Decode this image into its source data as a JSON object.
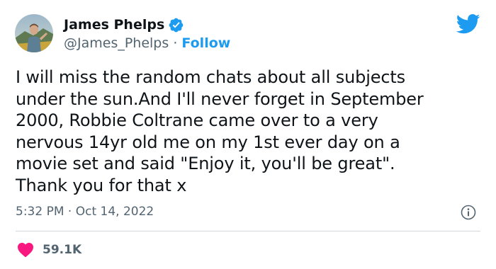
{
  "author": {
    "name": "James Phelps",
    "handle": "@James_Phelps",
    "separator": "·",
    "follow_label": "Follow",
    "verified": true,
    "avatar_icon": "profile-photo"
  },
  "brand": {
    "logo_icon": "twitter-bird-icon",
    "accent_color": "#1d9bf0"
  },
  "tweet": {
    "lines": [
      "I will miss the random chats about all subjects",
      "under the sun.And I'll never forget in September",
      "2000, Robbie Coltrane came over to a very",
      "nervous 14yr old me on my 1st ever day on a",
      "movie set and said \"Enjoy it, you'll be great\".",
      "Thank you for that x"
    ],
    "time": "5:32 PM",
    "date_separator": "·",
    "date": "Oct 14, 2022"
  },
  "stats": {
    "like_count": "59.1K",
    "like_icon": "heart-icon",
    "like_color": "#f91880"
  },
  "info_icon": "info-icon"
}
